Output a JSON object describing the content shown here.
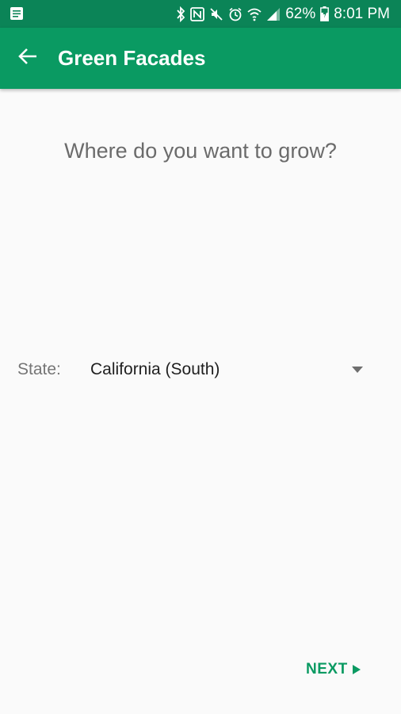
{
  "status_bar": {
    "battery_percent": "62%",
    "time": "8:01 PM",
    "icons": [
      "notes-icon",
      "bluetooth-icon",
      "nfc-icon",
      "mute-icon",
      "alarm-icon",
      "wifi-icon",
      "signal-icon",
      "battery-icon"
    ]
  },
  "app_bar": {
    "title": "Green Facades",
    "back_icon": "arrow-back-icon"
  },
  "main": {
    "question": "Where do you want to grow?",
    "state_label": "State:",
    "state_value": "California (South)"
  },
  "footer": {
    "next_label": "NEXT"
  },
  "colors": {
    "status_bar": "#0b8457",
    "app_bar": "#0a9a62",
    "accent": "#0a9a62",
    "background": "#fafafa"
  }
}
